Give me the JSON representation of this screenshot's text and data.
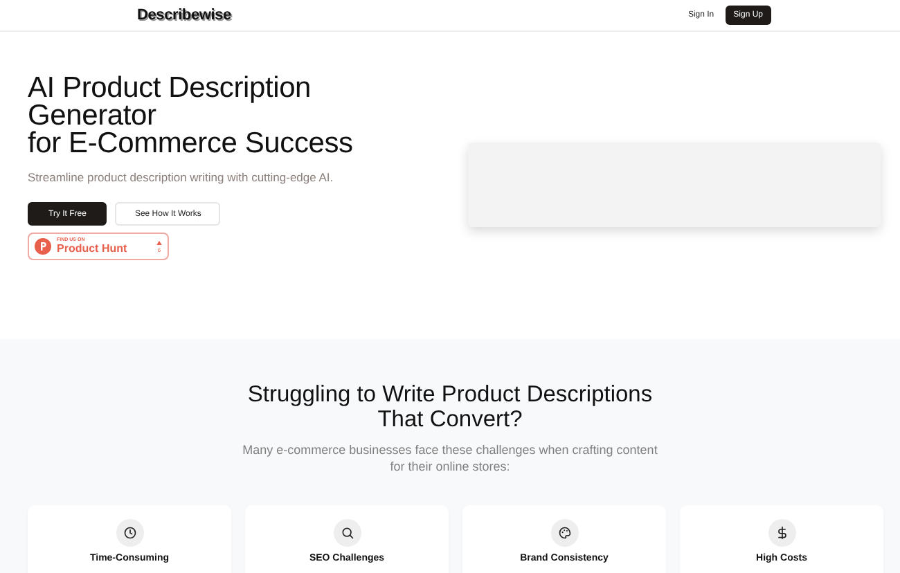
{
  "nav": {
    "logo": "Describewise",
    "sign_in": "Sign In",
    "sign_up": "Sign Up"
  },
  "hero": {
    "title_lines": [
      "AI Product Description",
      "Generator",
      "for E-Commerce Success"
    ],
    "subtitle": "Streamline product description writing with cutting-edge AI.",
    "buttons": [
      {
        "label": "Try It Free",
        "kind": "primary"
      },
      {
        "label": "See How It Works",
        "kind": "secondary"
      }
    ],
    "badge": {
      "small": "FIND US ON",
      "name": "Product Hunt",
      "count": "6"
    }
  },
  "problems": {
    "title_lines": [
      "Struggling to Write Product Descriptions",
      "That Convert?"
    ],
    "subtitle": "Many e-commerce businesses face these challenges when crafting content for their online stores:",
    "cards": [
      {
        "title": "Time-Consuming"
      },
      {
        "title": "SEO Challenges"
      },
      {
        "title": "Brand Consistency"
      },
      {
        "title": "High Costs"
      }
    ]
  }
}
